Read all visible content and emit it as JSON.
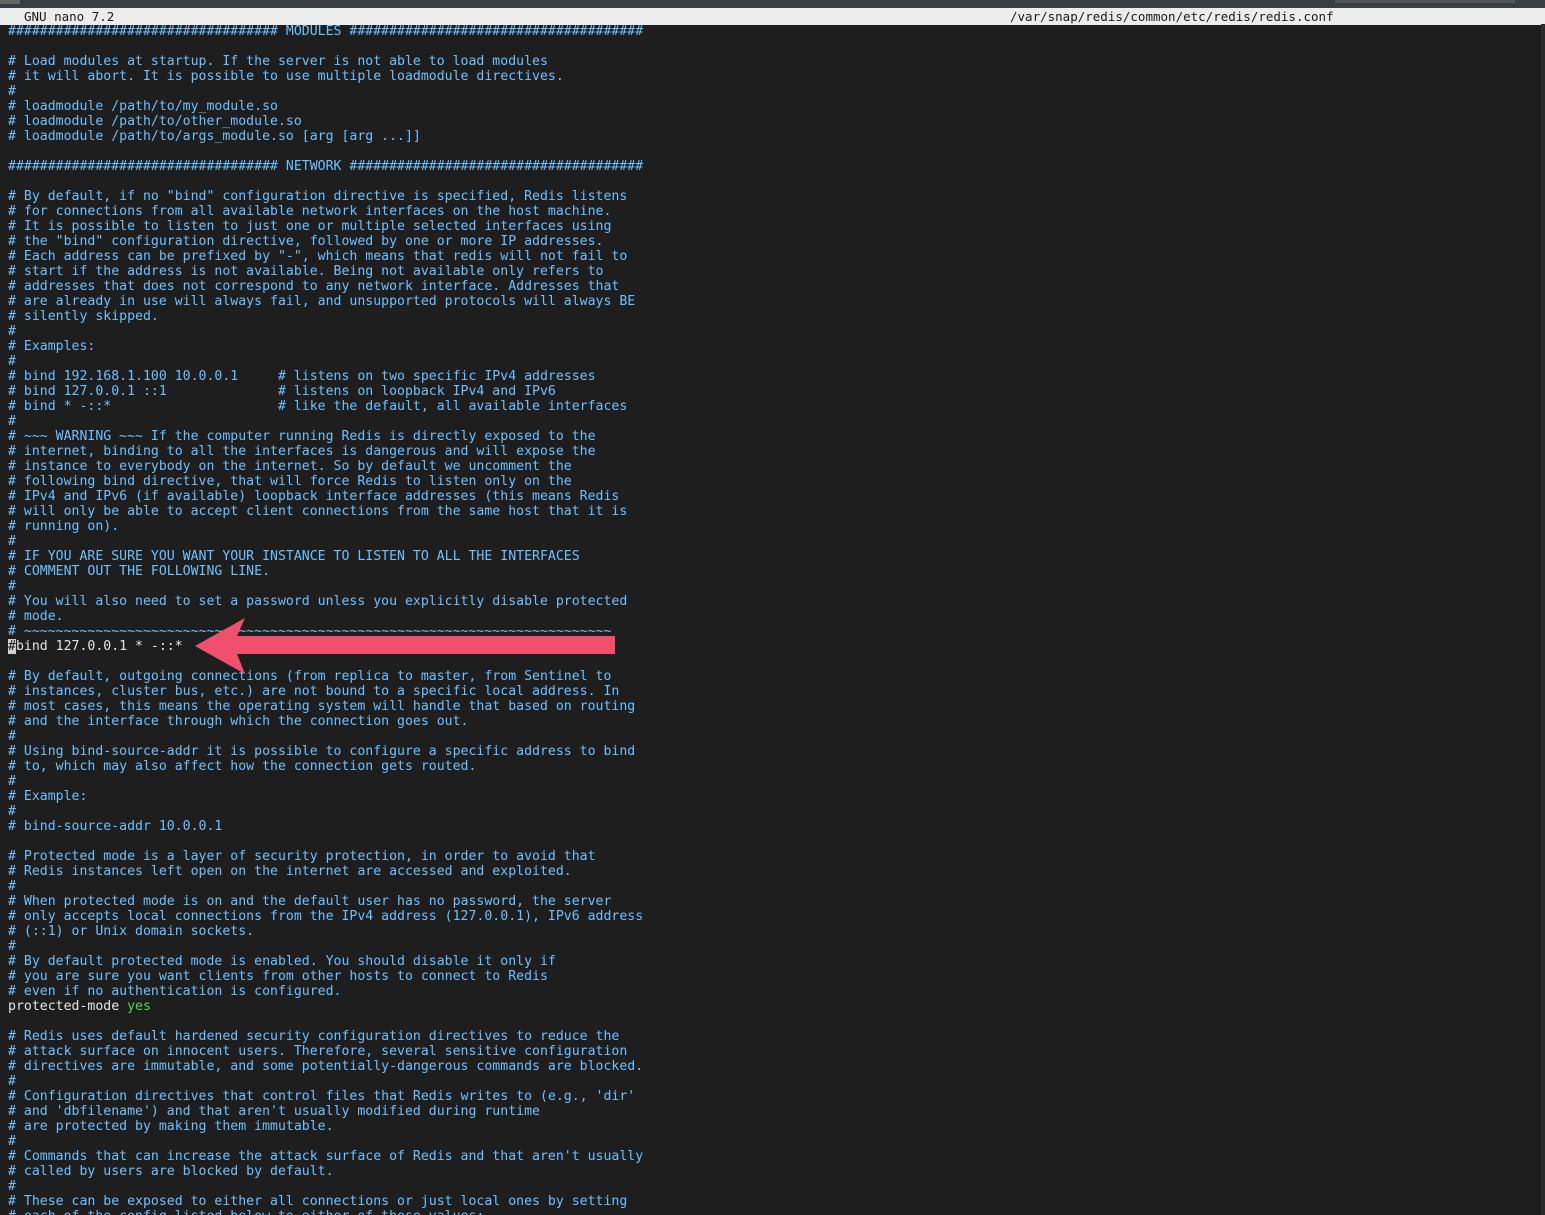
{
  "titlebar": {
    "app": "GNU nano 7.2",
    "file": "/var/snap/redis/common/etc/redis/redis.conf"
  },
  "colors": {
    "comment": "#6fc0ff",
    "directive": "#e6e6e6",
    "value": "#4cd94c",
    "background": "#1e1e1e",
    "annotation_arrow": "#f0506e"
  },
  "editor": {
    "lines": [
      "################################## MODULES #####################################",
      "",
      "# Load modules at startup. If the server is not able to load modules",
      "# it will abort. It is possible to use multiple loadmodule directives.",
      "#",
      "# loadmodule /path/to/my_module.so",
      "# loadmodule /path/to/other_module.so",
      "# loadmodule /path/to/args_module.so [arg [arg ...]]",
      "",
      "################################## NETWORK #####################################",
      "",
      "# By default, if no \"bind\" configuration directive is specified, Redis listens",
      "# for connections from all available network interfaces on the host machine.",
      "# It is possible to listen to just one or multiple selected interfaces using",
      "# the \"bind\" configuration directive, followed by one or more IP addresses.",
      "# Each address can be prefixed by \"-\", which means that redis will not fail to",
      "# start if the address is not available. Being not available only refers to",
      "# addresses that does not correspond to any network interface. Addresses that",
      "# are already in use will always fail, and unsupported protocols will always BE",
      "# silently skipped.",
      "#",
      "# Examples:",
      "#",
      "# bind 192.168.1.100 10.0.0.1     # listens on two specific IPv4 addresses",
      "# bind 127.0.0.1 ::1              # listens on loopback IPv4 and IPv6",
      "# bind * -::*                     # like the default, all available interfaces",
      "#",
      "# ~~~ WARNING ~~~ If the computer running Redis is directly exposed to the",
      "# internet, binding to all the interfaces is dangerous and will expose the",
      "# instance to everybody on the internet. So by default we uncomment the",
      "# following bind directive, that will force Redis to listen only on the",
      "# IPv4 and IPv6 (if available) loopback interface addresses (this means Redis",
      "# will only be able to accept client connections from the same host that it is",
      "# running on).",
      "#",
      "# IF YOU ARE SURE YOU WANT YOUR INSTANCE TO LISTEN TO ALL THE INTERFACES",
      "# COMMENT OUT THE FOLLOWING LINE.",
      "#",
      "# You will also need to set a password unless you explicitly disable protected",
      "# mode.",
      "# ~~~~~~~~~~~~~~~~~~~~~~~~~~~~~~~~~~~~~~~~~~~~~~~~~~~~~~~~~~~~~~~~~~~~~~~~~~",
      "__CURSOR_LINE__",
      "",
      "# By default, outgoing connections (from replica to master, from Sentinel to",
      "# instances, cluster bus, etc.) are not bound to a specific local address. In",
      "# most cases, this means the operating system will handle that based on routing",
      "# and the interface through which the connection goes out.",
      "#",
      "# Using bind-source-addr it is possible to configure a specific address to bind",
      "# to, which may also affect how the connection gets routed.",
      "#",
      "# Example:",
      "#",
      "# bind-source-addr 10.0.0.1",
      "",
      "# Protected mode is a layer of security protection, in order to avoid that",
      "# Redis instances left open on the internet are accessed and exploited.",
      "#",
      "# When protected mode is on and the default user has no password, the server",
      "# only accepts local connections from the IPv4 address (127.0.0.1), IPv6 address",
      "# (::1) or Unix domain sockets.",
      "#",
      "# By default protected mode is enabled. You should disable it only if",
      "# you are sure you want clients from other hosts to connect to Redis",
      "# even if no authentication is configured.",
      "__PROTECTED_LINE__",
      "",
      "# Redis uses default hardened security configuration directives to reduce the",
      "# attack surface on innocent users. Therefore, several sensitive configuration",
      "# directives are immutable, and some potentially-dangerous commands are blocked.",
      "#",
      "# Configuration directives that control files that Redis writes to (e.g., 'dir'",
      "# and 'dbfilename') and that aren't usually modified during runtime",
      "# are protected by making them immutable.",
      "#",
      "# Commands that can increase the attack surface of Redis and that aren't usually",
      "# called by users are blocked by default.",
      "#",
      "# These can be exposed to either all connections or just local ones by setting",
      "# each of the config listed below to either of these values:"
    ],
    "cursor_line": {
      "cursor_char": "#",
      "rest": "bind 127.0.0.1 * -::*"
    },
    "protected_line": {
      "directive": "protected-mode",
      "value": "yes"
    }
  }
}
